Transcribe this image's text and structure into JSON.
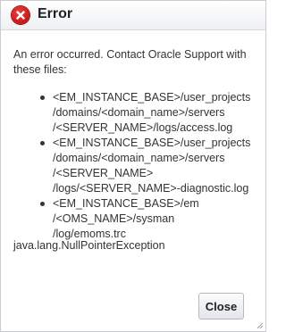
{
  "dialog": {
    "title": "Error",
    "intro": "An error occurred. Contact Oracle Support with these files:",
    "files": [
      {
        "lines": [
          "<EM_INSTANCE_BASE>/user_projects",
          "/domains/<domain_name>/servers",
          "/<SERVER_NAME>/logs/access.log"
        ]
      },
      {
        "lines": [
          "<EM_INSTANCE_BASE>/user_projects",
          "/domains/<domain_name>/servers",
          "/<SERVER_NAME>",
          "/logs/<SERVER_NAME>-diagnostic.log"
        ]
      },
      {
        "lines": [
          "<EM_INSTANCE_BASE>/em",
          "/<OMS_NAME>/sysman",
          "/log/emoms.trc"
        ]
      }
    ],
    "exception": "java.lang.NullPointerException",
    "close_label": "Close"
  },
  "colors": {
    "error_red": "#c81717",
    "text": "#333333",
    "border": "#c9cdd2"
  },
  "icons": {
    "title_icon": "error-x-circle-icon"
  }
}
